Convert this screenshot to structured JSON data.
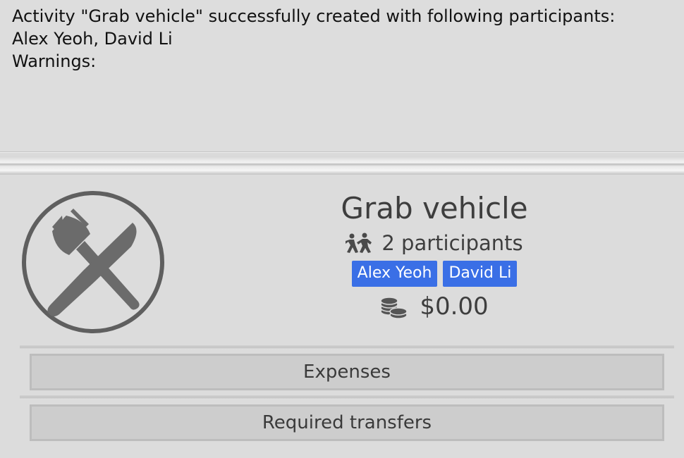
{
  "result": {
    "lines": [
      "Activity \"Grab vehicle\" successfully created with following participants:",
      "Alex Yeoh, David Li",
      "Warnings:"
    ]
  },
  "activity": {
    "icon": "fork-knife-icon",
    "title": "Grab vehicle",
    "participants_icon": "people-icon",
    "participants_text": "2 participants",
    "participants": [
      "Alex Yeoh",
      "David Li"
    ],
    "amount_icon": "coins-icon",
    "amount": "$0.00",
    "tag_color": "#3a6fe6"
  },
  "buttons": {
    "expenses": "Expenses",
    "transfers": "Required transfers"
  }
}
